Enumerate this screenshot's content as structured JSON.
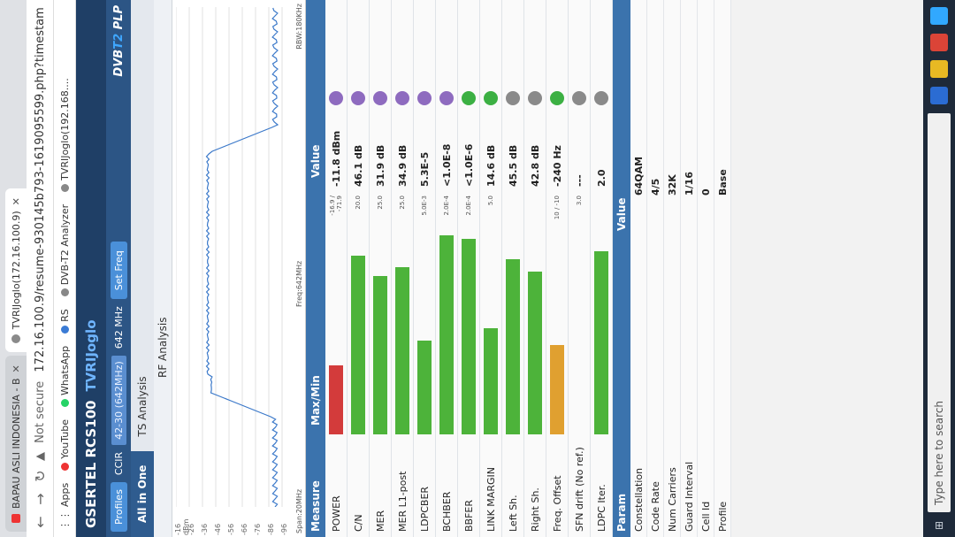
{
  "browser": {
    "tabs": [
      {
        "title": "BAPAU ASLI INDONESIA - B",
        "active": false
      },
      {
        "title": "TVRIJoglo(172.16.100.9)",
        "active": true
      }
    ],
    "security": "Not secure",
    "url": "172.16.100.9/resume-930145b793-1619095599.php?timestamp",
    "bookmarks": [
      "Apps",
      "YouTube",
      "WhatsApp",
      "RS",
      "DVB-T2 Analyzer",
      "TVRIJoglo(192.168...."
    ]
  },
  "app": {
    "brand": "GSERTEL RCS100",
    "device": "TVRIJoglo",
    "profiles_label": "Profiles",
    "standard": "CCIR",
    "channel_select": "42-30 (642MHz)",
    "frequency": "642 MHz",
    "set_freq": "Set Freq",
    "logo_main": "DVB",
    "logo_t2": "T2",
    "logo_plp": "PLP"
  },
  "tabs": [
    "All in One",
    "TS Analysis"
  ],
  "rf_section": "RF Analysis",
  "spectrum": {
    "y_labels": [
      "-16 dBm",
      "-26",
      "-36",
      "-46",
      "-56",
      "-66",
      "-76",
      "-86",
      "-96"
    ],
    "span": "Span:20MHz",
    "center": "Freq:642MHz",
    "rbw": "RBW:180KHz"
  },
  "measure": {
    "headers": {
      "measure": "Measure",
      "maxmin": "Max/Min",
      "value": "Value"
    },
    "rows": [
      {
        "name": "POWER",
        "fill": 0.34,
        "color": "#d33b3b",
        "th": "-16.9 / -71.9",
        "value": "-11.8 dBm",
        "led": "#8e6bbf"
      },
      {
        "name": "C/N",
        "fill": 0.88,
        "color": "#4db33a",
        "th": "20.0",
        "value": "46.1 dB",
        "led": "#8e6bbf"
      },
      {
        "name": "MER",
        "fill": 0.78,
        "color": "#4db33a",
        "th": "25.0",
        "value": "31.9 dB",
        "led": "#8e6bbf"
      },
      {
        "name": "MER L1-post",
        "fill": 0.82,
        "color": "#4db33a",
        "th": "25.0",
        "value": "34.9 dB",
        "led": "#8e6bbf"
      },
      {
        "name": "LDPCBER",
        "fill": 0.46,
        "color": "#4db33a",
        "th": "5.0E-3",
        "value": "5.3E-5",
        "led": "#8e6bbf"
      },
      {
        "name": "BCHBER",
        "fill": 0.98,
        "color": "#4db33a",
        "th": "2.0E-4",
        "value": "<1.0E-8",
        "led": "#8e6bbf"
      },
      {
        "name": "BBFER",
        "fill": 0.96,
        "color": "#4db33a",
        "th": "2.0E-4",
        "value": "<1.0E-6",
        "led": "#3cb043"
      },
      {
        "name": "LINK MARGIN",
        "fill": 0.52,
        "color": "#4db33a",
        "th": "5.0",
        "value": "14.6 dB",
        "led": "#3cb043"
      },
      {
        "name": "Left Sh.",
        "fill": 0.86,
        "color": "#4db33a",
        "th": "",
        "value": "45.5 dB",
        "led": "#8a8a8a"
      },
      {
        "name": "Right Sh.",
        "fill": 0.8,
        "color": "#4db33a",
        "th": "",
        "value": "42.8 dB",
        "led": "#8a8a8a"
      },
      {
        "name": "Freq. Offset",
        "fill": 0.44,
        "color": "#e0a030",
        "th": "10 / -10",
        "value": "-240 Hz",
        "led": "#3cb043"
      },
      {
        "name": "SFN drift (No ref.)",
        "fill": 0.0,
        "color": "#4db33a",
        "th": "3.0",
        "value": "---",
        "led": "#8a8a8a"
      },
      {
        "name": "LDPC Iter.",
        "fill": 0.9,
        "color": "#4db33a",
        "th": "",
        "value": "2.0",
        "led": "#8a8a8a"
      }
    ]
  },
  "param": {
    "header": "Param",
    "value_header": "Value",
    "rows": [
      {
        "name": "Constellation",
        "value": "64QAM"
      },
      {
        "name": "Code Rate",
        "value": "4/5"
      },
      {
        "name": "Num Carriers",
        "value": "32K"
      },
      {
        "name": "Guard Interval",
        "value": "1/16"
      },
      {
        "name": "Cell Id",
        "value": "0"
      },
      {
        "name": "Profile",
        "value": "Base"
      }
    ]
  },
  "taskbar": {
    "search_placeholder": "Type here to search"
  }
}
